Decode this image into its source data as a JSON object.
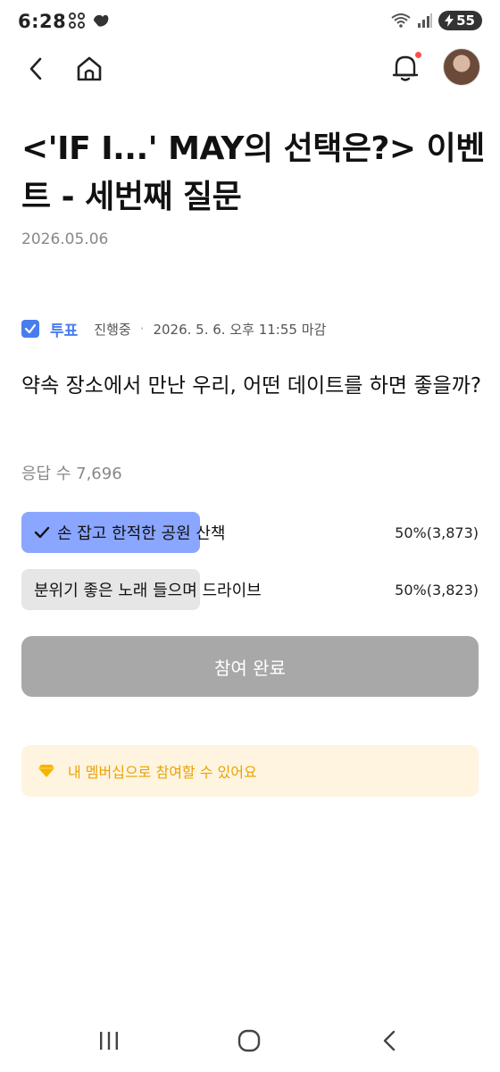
{
  "status": {
    "time": "6:28",
    "battery": "55"
  },
  "header": {
    "avatar_alt": "profile"
  },
  "post": {
    "title": "<'IF I...' MAY의 선택은?> 이벤트 - 세번째 질문",
    "date": "2026.05.06"
  },
  "poll": {
    "label": "투표",
    "status": "진행중",
    "separator": "·",
    "deadline": "2026. 5. 6. 오후 11:55 마감",
    "question": "약속 장소에서 만난 우리, 어떤 데이트를 하면 좋을까?",
    "responses": "응답 수 7,696",
    "options": [
      {
        "text": "손 잡고 한적한 공원 산책",
        "result": "50%(3,873)",
        "percent": 50,
        "selected": true
      },
      {
        "text": "분위기 좋은 노래 들으며 드라이브",
        "result": "50%(3,823)",
        "percent": 50,
        "selected": false
      }
    ],
    "submit_label": "참여 완료"
  },
  "membership": {
    "text": "내 멤버십으로 참여할 수 있어요"
  },
  "colors": {
    "accent": "#4a7cf0",
    "selected_fill": "#8aa6ff",
    "unselected_fill": "#e6e6e6",
    "button": "#a8a8a8",
    "membership_bg": "#fff4e0",
    "membership_text": "#e8a300"
  }
}
